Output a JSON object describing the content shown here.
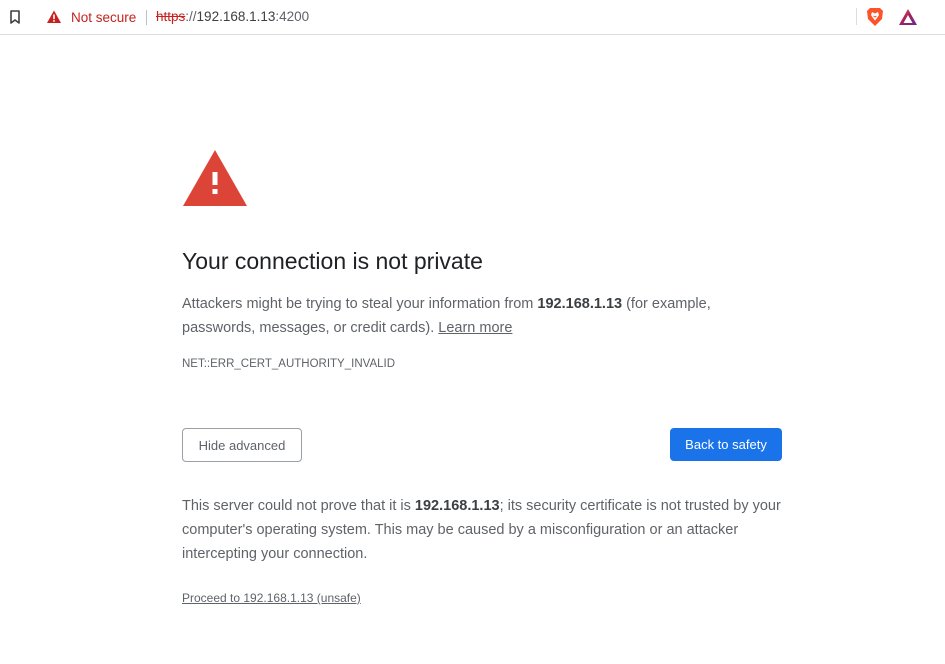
{
  "browser": {
    "security_label": "Not secure",
    "url_scheme": "https",
    "url_separator": "://",
    "url_host": "192.168.1.13",
    "url_port": ":4200",
    "icons": {
      "bookmark": "bookmark-icon",
      "security": "warning-triangle-icon",
      "brave_shields": "brave-lion-icon",
      "brave_rewards": "brave-rewards-triangle-icon"
    },
    "colors": {
      "security_red": "#c5221f",
      "brave_orange": "#fb542b",
      "rewards_purple": "#662d91"
    }
  },
  "page": {
    "title": "Your connection is not private",
    "summary": {
      "prefix": "Attackers might be trying to steal your information from ",
      "host": "192.168.1.13",
      "suffix": " (for example, passwords, messages, or credit cards). ",
      "learn_more": "Learn more"
    },
    "error_code": "NET::ERR_CERT_AUTHORITY_INVALID",
    "hide_advanced_label": "Hide advanced",
    "back_to_safety_label": "Back to safety",
    "details": {
      "prefix": "This server could not prove that it is ",
      "host": "192.168.1.13",
      "suffix": "; its security certificate is not trusted by your computer's operating system. This may be caused by a misconfiguration or an attacker intercepting your connection."
    },
    "proceed_link": "Proceed to 192.168.1.13 (unsafe)",
    "colors": {
      "warning_red": "#db4437",
      "primary_blue": "#1a73e8",
      "heading_text": "#202124",
      "body_text": "#5f6368"
    }
  }
}
